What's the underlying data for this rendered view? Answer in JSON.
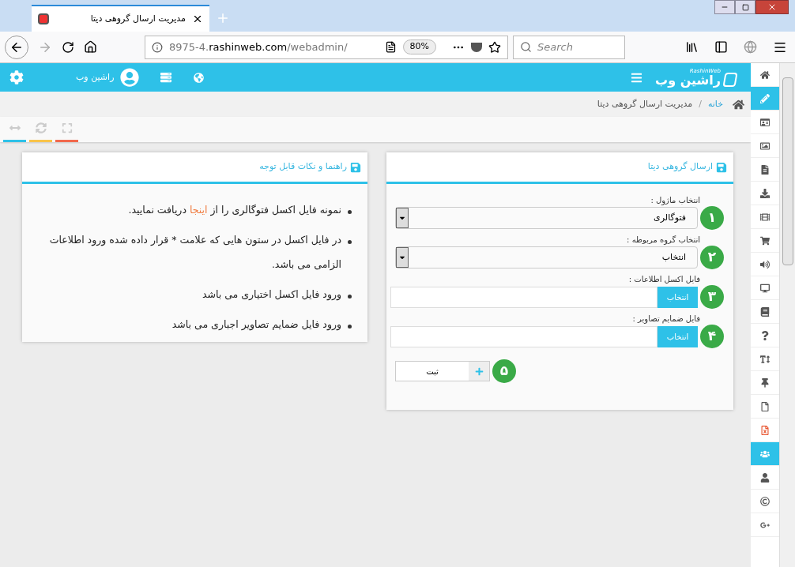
{
  "browser": {
    "tab_title": "مدیریت ارسال گروهی دیتا",
    "url_prefix": "8975-4.",
    "url_domain": "rashinweb.com",
    "url_path": "/webadmin/",
    "zoom": "80%",
    "search": {
      "placeholder": "Search"
    }
  },
  "header": {
    "brand": "راشین وب",
    "brand_latin": "RashinWeb",
    "user": "راشین وب"
  },
  "breadcrumb_separator": "/",
  "breadcrumb": [
    {
      "label": "خانه",
      "kind": "link"
    },
    {
      "label": "مدیریت ارسال گروهی دیتا",
      "kind": "current"
    }
  ],
  "toolbar": [
    {
      "kind": "resize",
      "color": "#2ec1e8"
    },
    {
      "kind": "refresh",
      "color": "#f9c44a"
    },
    {
      "kind": "fullscreen",
      "color": "#f2694d"
    }
  ],
  "form_panel": {
    "title": "ارسال گروهی دیتا",
    "fields": [
      {
        "kind": "select",
        "label": "انتخاب ماژول :",
        "value": "فتوگالری",
        "badge": "۱"
      },
      {
        "kind": "select",
        "label": "انتخاب گروه مربوطه :",
        "value": "انتخاب",
        "badge": "۲"
      },
      {
        "kind": "file",
        "label": "فایل اکسل اطلاعات :",
        "button": "انتخاب",
        "badge": "۳"
      },
      {
        "kind": "file",
        "label": "فایل ضمایم تصاویر :",
        "button": "انتخاب",
        "badge": "۴"
      }
    ],
    "submit": {
      "label": "ثبت",
      "badge": "۵"
    }
  },
  "help_panel": {
    "title": "راهنما و نکات قابل توجه",
    "items": [
      {
        "before": "نمونه فایل اکسل فتوگالری را از ",
        "link": "اینجا",
        "after": " دریافت نمایید."
      },
      {
        "before": "در فایل اکسل در ستون هایی که علامت * قرار داده شده ورود اطلاعات الزامی می باشد."
      },
      {
        "before": "ورود فایل اکسل اختیاری می باشد"
      },
      {
        "before": "ورود فایل ضمایم تصاویر اجباری می باشد"
      }
    ]
  },
  "sidebar": [
    {
      "kind": "home",
      "selected": false
    },
    {
      "kind": "pencil",
      "selected": true
    },
    {
      "kind": "card",
      "selected": false
    },
    {
      "kind": "image",
      "selected": false
    },
    {
      "kind": "document",
      "selected": false
    },
    {
      "kind": "download",
      "selected": false
    },
    {
      "kind": "film",
      "selected": false
    },
    {
      "kind": "cart",
      "selected": false
    },
    {
      "kind": "speaker",
      "selected": false
    },
    {
      "kind": "monitor",
      "selected": false
    },
    {
      "kind": "book",
      "selected": false
    },
    {
      "kind": "question",
      "selected": false
    },
    {
      "kind": "text-height",
      "selected": false
    },
    {
      "kind": "pin",
      "selected": false
    },
    {
      "kind": "file",
      "selected": false
    },
    {
      "kind": "excel",
      "selected": false
    },
    {
      "kind": "users",
      "selected": true
    },
    {
      "kind": "user",
      "selected": false
    },
    {
      "kind": "copyright",
      "selected": false
    },
    {
      "kind": "gplus",
      "selected": false
    }
  ]
}
